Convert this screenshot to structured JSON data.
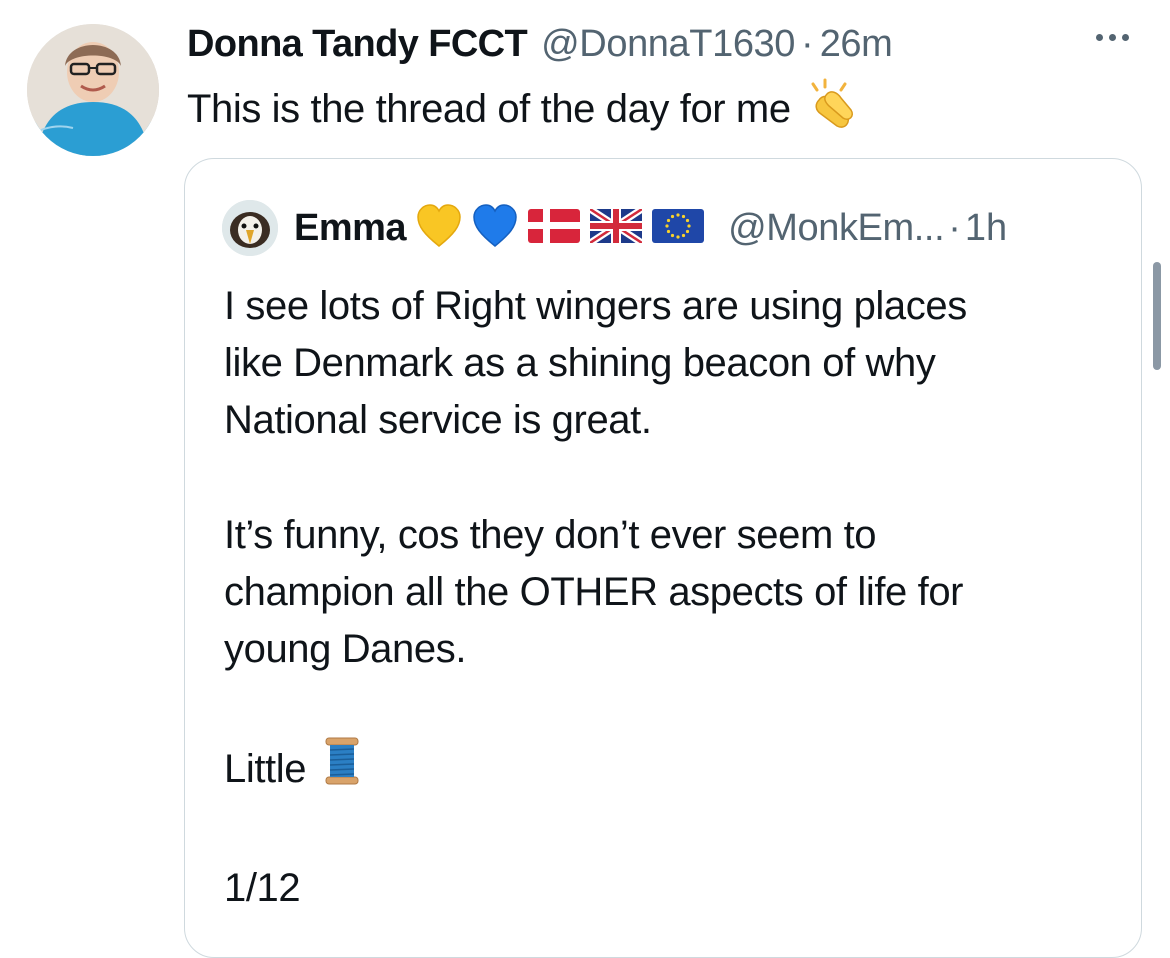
{
  "post": {
    "author_name": "Donna Tandy FCCT",
    "author_handle": "@DonnaT1630",
    "separator": "·",
    "time": "26m",
    "text": "This is the thread of the day for me",
    "emoji": "clapping-hands-icon"
  },
  "quoted": {
    "author_name": "Emma",
    "badges": [
      "yellow-heart-icon",
      "blue-heart-icon",
      "denmark-flag-icon",
      "uk-flag-icon",
      "eu-flag-icon"
    ],
    "author_handle": "@MonkEm...",
    "separator": "·",
    "time": "1h",
    "paragraphs": [
      [
        "I see lots of Right wingers are using places",
        "like Denmark as a shining beacon of why",
        "National service is great."
      ],
      [
        "It’s funny, cos they don’t ever seem to",
        "champion all the OTHER aspects of life for",
        "young Danes."
      ]
    ],
    "little": "Little",
    "little_emoji": "spool-of-thread-icon",
    "counter": "1/12"
  },
  "colors": {
    "text": "#0f1419",
    "secondary": "#536471",
    "border": "#cfd9de",
    "background": "#ffffff"
  }
}
